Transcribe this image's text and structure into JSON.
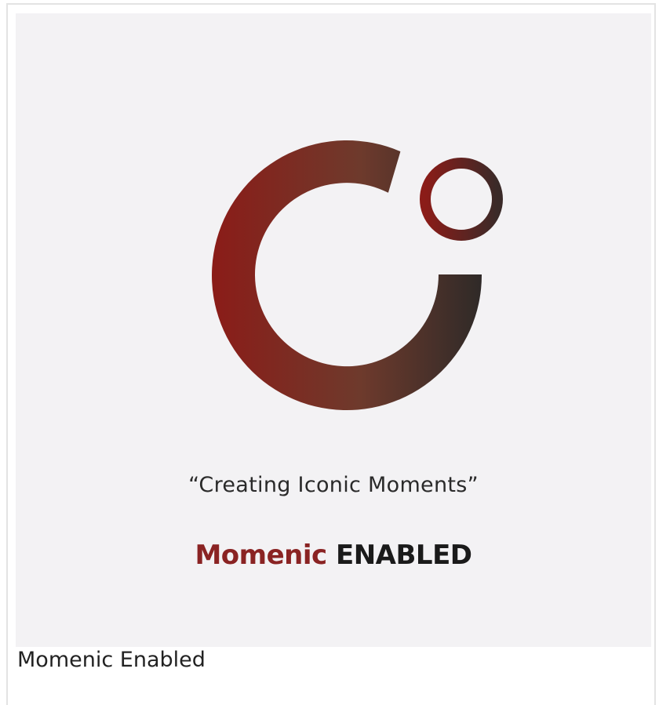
{
  "image": {
    "tagline": "“Creating Iconic Moments”",
    "brand_word1": "Momenic",
    "brand_word2": "ENABLED",
    "brand_color": "#8a2323",
    "logo_icon": "momenic-logo-icon",
    "logo_gradient": [
      "#8b1c18",
      "#2f2a28"
    ]
  },
  "caption": "Momenic Enabled"
}
